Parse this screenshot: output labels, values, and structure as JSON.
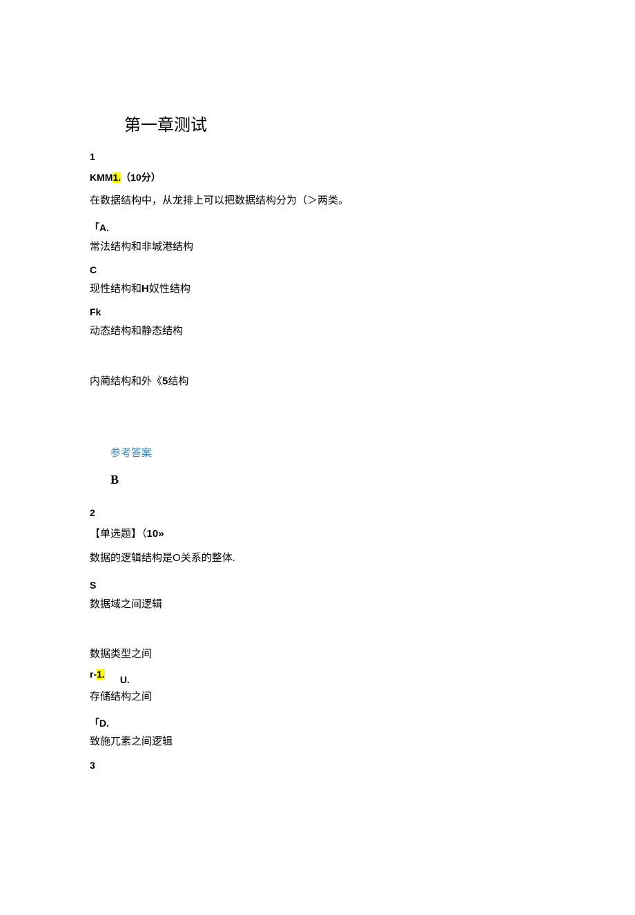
{
  "chapter_title": "第一章测试",
  "q1": {
    "number": "1",
    "header_prefix": "KMM",
    "header_highlight": "1.",
    "header_points": "（10分）",
    "stem": "在数据结构中，从龙排上可以把数据结构分为（＞两类。",
    "optA_label": "「A.",
    "optA_text": "常法结构和非城港结构",
    "optB_label": "C",
    "optB_text_pre": "现性结构和",
    "optB_text_bold": "H",
    "optB_text_post": "奴性结构",
    "optC_label": "Fk",
    "optC_text": "动态结构和静态结构",
    "optD_text_pre": "内蔺结构和外《",
    "optD_text_bold": "5",
    "optD_text_post": "结构",
    "answer_label": "参考答案",
    "answer_value": "B"
  },
  "q2": {
    "number": "2",
    "header": "【单选题】（10»",
    "stem_pre": "数据的逻辑结构是",
    "stem_o": "O",
    "stem_post": "关系的整体.",
    "optA_label": "S",
    "optA_text": "数据域之间逻辑",
    "optB_text": "数据类型之间",
    "optC_r1_pre": "r-",
    "optC_r1_hl": "1.",
    "optC_u": "U.",
    "optC_text": "存储结构之间",
    "optD_label": "「D.",
    "optD_text": "致施兀素之间逻辑"
  },
  "q3": {
    "number": "3"
  }
}
